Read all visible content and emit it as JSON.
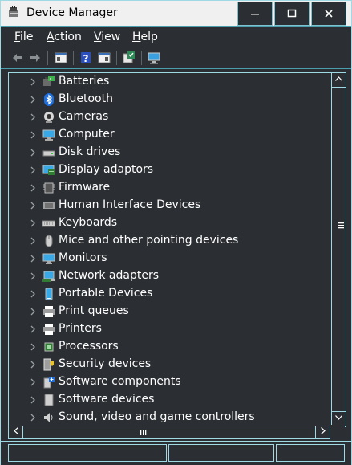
{
  "window": {
    "title": "Device Manager",
    "buttons": {
      "minimize": "—",
      "maximize": "☐",
      "close": "✕"
    }
  },
  "menu": [
    {
      "label": "File",
      "accel": "F",
      "rest": "ile"
    },
    {
      "label": "Action",
      "accel": "A",
      "rest": "ction"
    },
    {
      "label": "View",
      "accel": "V",
      "rest": "iew"
    },
    {
      "label": "Help",
      "accel": "H",
      "rest": "elp"
    }
  ],
  "toolbar": {
    "icons": [
      "back-arrow-icon",
      "forward-arrow-icon",
      "properties-icon",
      "help-icon",
      "show-hide-console-tree-icon",
      "update-driver-icon",
      "scan-hardware-icon"
    ]
  },
  "tree": {
    "items": [
      {
        "label": "Batteries",
        "icon": "battery-icon"
      },
      {
        "label": "Bluetooth",
        "icon": "bluetooth-icon"
      },
      {
        "label": "Cameras",
        "icon": "camera-icon"
      },
      {
        "label": "Computer",
        "icon": "computer-icon"
      },
      {
        "label": "Disk drives",
        "icon": "disk-drive-icon"
      },
      {
        "label": "Display adaptors",
        "icon": "display-adapter-icon"
      },
      {
        "label": "Firmware",
        "icon": "firmware-icon"
      },
      {
        "label": "Human Interface Devices",
        "icon": "hid-icon"
      },
      {
        "label": "Keyboards",
        "icon": "keyboard-icon"
      },
      {
        "label": "Mice and other pointing devices",
        "icon": "mouse-icon"
      },
      {
        "label": "Monitors",
        "icon": "monitor-icon"
      },
      {
        "label": "Network adapters",
        "icon": "network-adapter-icon"
      },
      {
        "label": "Portable Devices",
        "icon": "portable-device-icon"
      },
      {
        "label": "Print queues",
        "icon": "print-queue-icon"
      },
      {
        "label": "Printers",
        "icon": "printer-icon"
      },
      {
        "label": "Processors",
        "icon": "processor-icon"
      },
      {
        "label": "Security devices",
        "icon": "security-device-icon"
      },
      {
        "label": "Software components",
        "icon": "software-component-icon"
      },
      {
        "label": "Software devices",
        "icon": "software-device-icon"
      },
      {
        "label": "Sound, video and game controllers",
        "icon": "sound-icon"
      }
    ]
  },
  "colors": {
    "background": "#2b2f33",
    "accent_border": "#9fd9e3",
    "text": "#ffffff",
    "titlebar": "#f0f0f0"
  }
}
